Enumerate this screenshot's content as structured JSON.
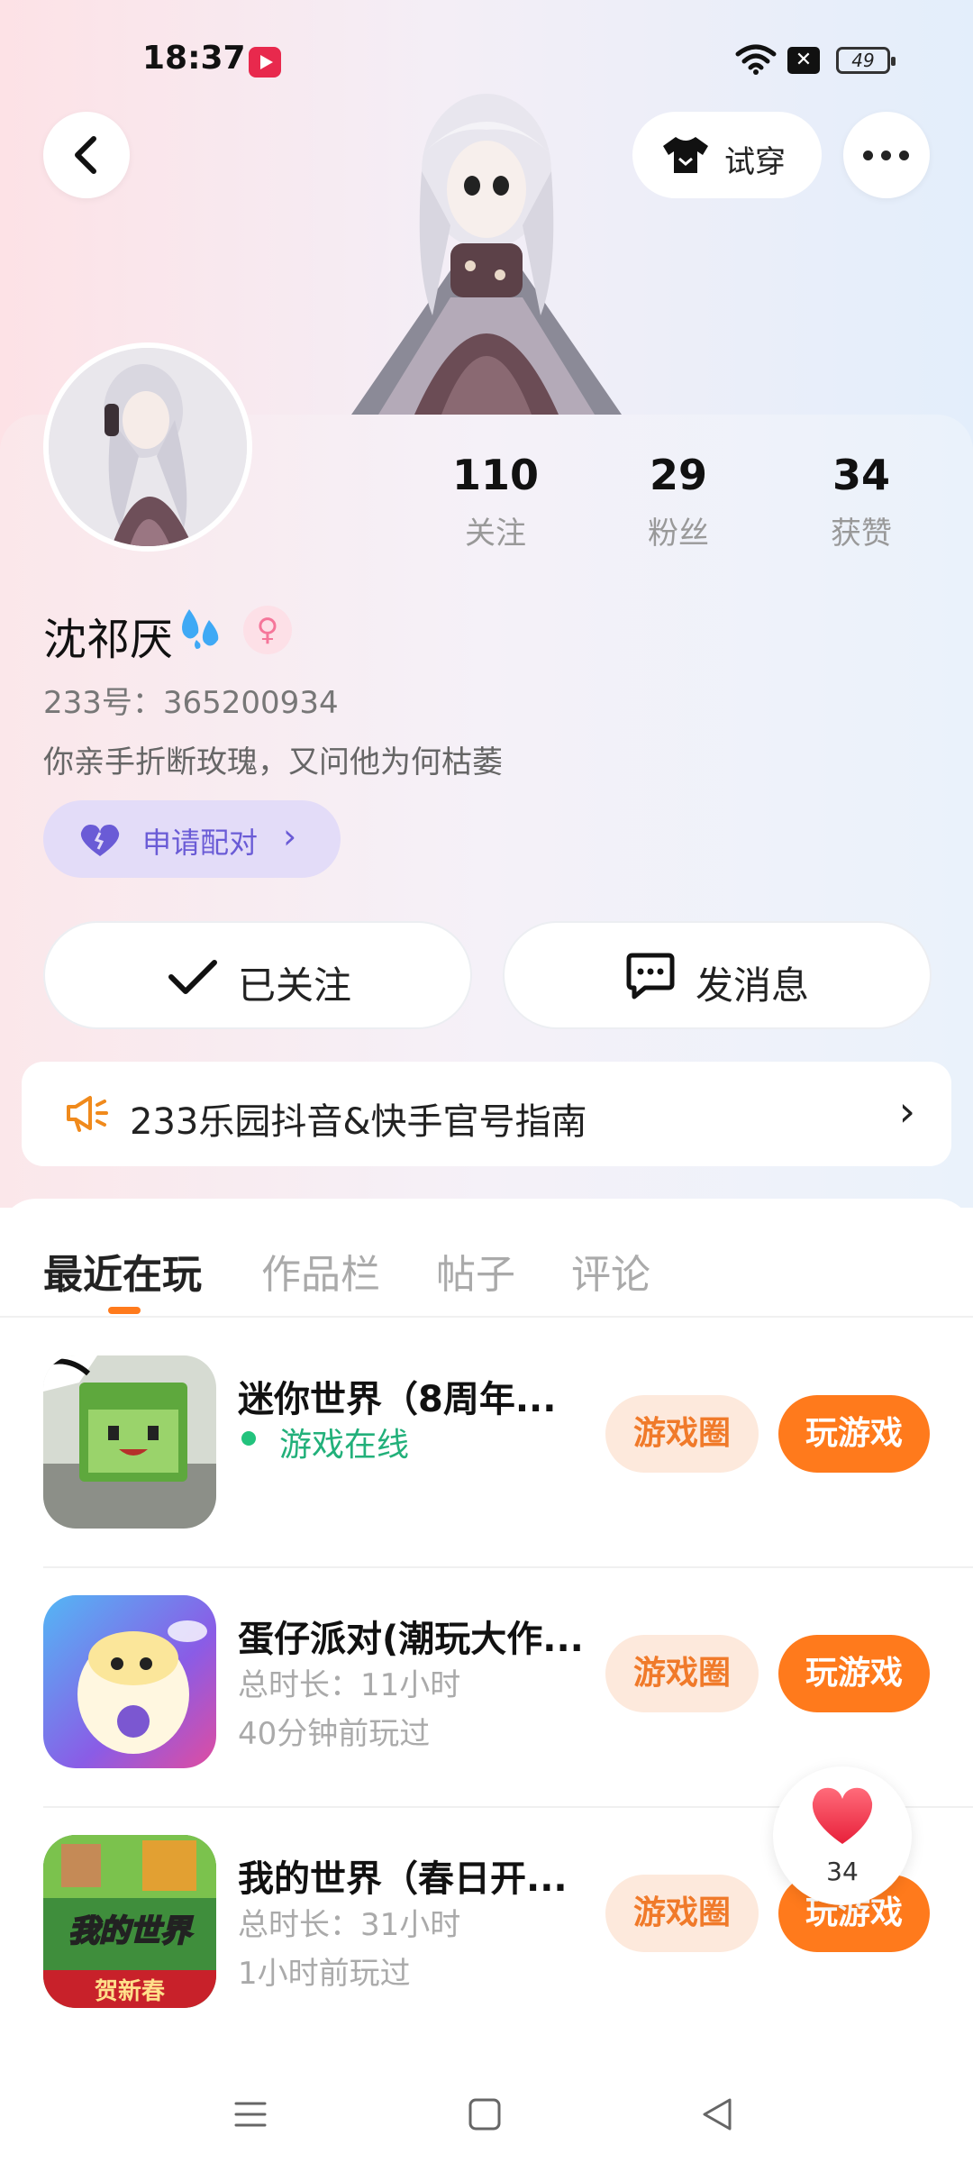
{
  "status_bar": {
    "time": "18:37",
    "battery": "49",
    "x_label": "✕"
  },
  "header": {
    "tryon_label": "试穿"
  },
  "stats": [
    {
      "num": "110",
      "label": "关注"
    },
    {
      "num": "29",
      "label": "粉丝"
    },
    {
      "num": "34",
      "label": "获赞"
    }
  ],
  "profile": {
    "name": "沈祁厌",
    "gender": "♀",
    "uid": "233号：365200934",
    "bio": "你亲手折断玫瑰，又问他为何枯萎",
    "pair_label": "申请配对",
    "pair_chevron": "›"
  },
  "actions": {
    "follow_label": "已关注",
    "message_label": "发消息"
  },
  "notice": {
    "text": "233乐园抖音&快手官号指南",
    "chevron": "›"
  },
  "tabs": [
    "最近在玩",
    "作品栏",
    "帖子",
    "评论"
  ],
  "games": [
    {
      "title": "迷你世界（8周年...",
      "online": "游戏在线",
      "circle_label": "游戏圈",
      "play_label": "玩游戏"
    },
    {
      "title": "蛋仔派对(潮玩大作...",
      "duration": "总时长：11小时",
      "last_played": "40分钟前玩过",
      "circle_label": "游戏圈",
      "play_label": "玩游戏"
    },
    {
      "title": "我的世界（春日开...",
      "duration": "总时长：31小时",
      "last_played": "1小时前玩过",
      "circle_label": "游戏圈",
      "play_label": "玩游戏",
      "icon_text_1": "我的世界",
      "icon_text_2": "贺新春"
    }
  ],
  "like_fab": {
    "count": "34"
  },
  "colors": {
    "accent": "#ff7a1c",
    "online": "#22c37d",
    "pair": "#6a5bd6"
  }
}
